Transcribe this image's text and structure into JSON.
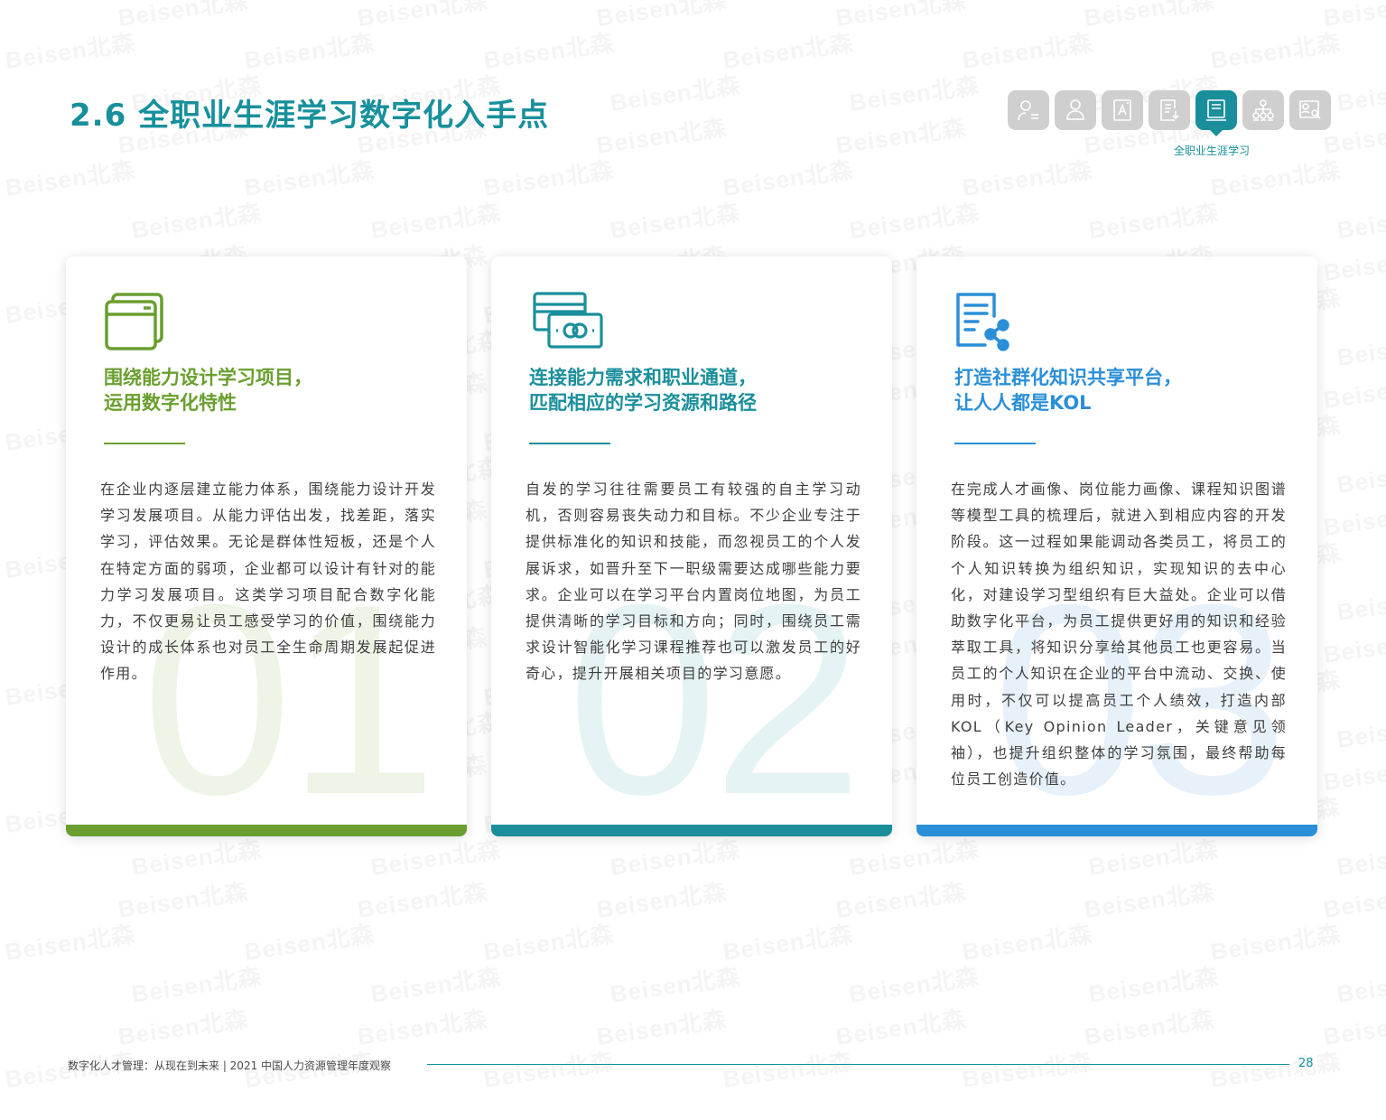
{
  "page": {
    "title": "2.6 全职业生涯学习数字化入手点",
    "accent_color": "#17909c"
  },
  "watermark": {
    "text": "Beisen北森"
  },
  "nav": {
    "icons": [
      {
        "name": "talent-profile-icon",
        "active": false
      },
      {
        "name": "person-org-icon",
        "active": false
      },
      {
        "name": "assessment-doc-icon",
        "active": false
      },
      {
        "name": "report-doc-icon",
        "active": false
      },
      {
        "name": "book-learning-icon",
        "active": true
      },
      {
        "name": "org-chart-icon",
        "active": false
      },
      {
        "name": "profile-search-icon",
        "active": false
      }
    ],
    "active_caption": "全职业生涯学习"
  },
  "cards": [
    {
      "number": "01",
      "icon": "browser-window-icon",
      "color": "#6a9f2f",
      "number_color": "#eef4e6",
      "heading_line1": "围绕能力设计学习项目，",
      "heading_line2": "运用数字化特性",
      "body": "在企业内逐层建立能力体系，围绕能力设计开发学习发展项目。从能力评估出发，找差距，落实学习，评估效果。无论是群体性短板，还是个人在特定方面的弱项，企业都可以设计有针对的能力学习发展项目。这类学习项目配合数字化能力，不仅更易让员工感受学习的价值，围绕能力设计的成长体系也对员工全生命周期发展起促进作用。"
    },
    {
      "number": "02",
      "icon": "card-money-icon",
      "color": "#1a8f9b",
      "number_color": "#e6f3f4",
      "heading_line1": "连接能力需求和职业通道，",
      "heading_line2": "匹配相应的学习资源和路径",
      "body": "自发的学习往往需要员工有较强的自主学习动机，否则容易丧失动力和目标。不少企业专注于提供标准化的知识和技能，而忽视员工的个人发展诉求，如晋升至下一职级需要达成哪些能力要求。企业可以在学习平台内置岗位地图，为员工提供清晰的学习目标和方向；同时，围绕员工需求设计智能化学习课程推荐也可以激发员工的好奇心，提升开展相关项目的学习意愿。"
    },
    {
      "number": "03",
      "icon": "document-share-icon",
      "color": "#2b8fd8",
      "number_color": "#e6f1fa",
      "heading_line1": "打造社群化知识共享平台，",
      "heading_line2": "让人人都是KOL",
      "body": "在完成人才画像、岗位能力画像、课程知识图谱等模型工具的梳理后，就进入到相应内容的开发阶段。这一过程如果能调动各类员工，将员工的个人知识转换为组织知识，实现知识的去中心化，对建设学习型组织有巨大益处。企业可以借助数字化平台，为员工提供更好用的知识和经验萃取工具，将知识分享给其他员工也更容易。当员工的个人知识在企业的平台中流动、交换、使用时，不仅可以提高员工个人绩效，打造内部KOL（Key Opinion Leader，关键意见领袖），也提升组织整体的学习氛围，最终帮助每位员工创造价值。"
    }
  ],
  "footer": {
    "text": "数字化人才管理：从现在到未来 | 2021 中国人力资源管理年度观察",
    "page_number": "28"
  }
}
